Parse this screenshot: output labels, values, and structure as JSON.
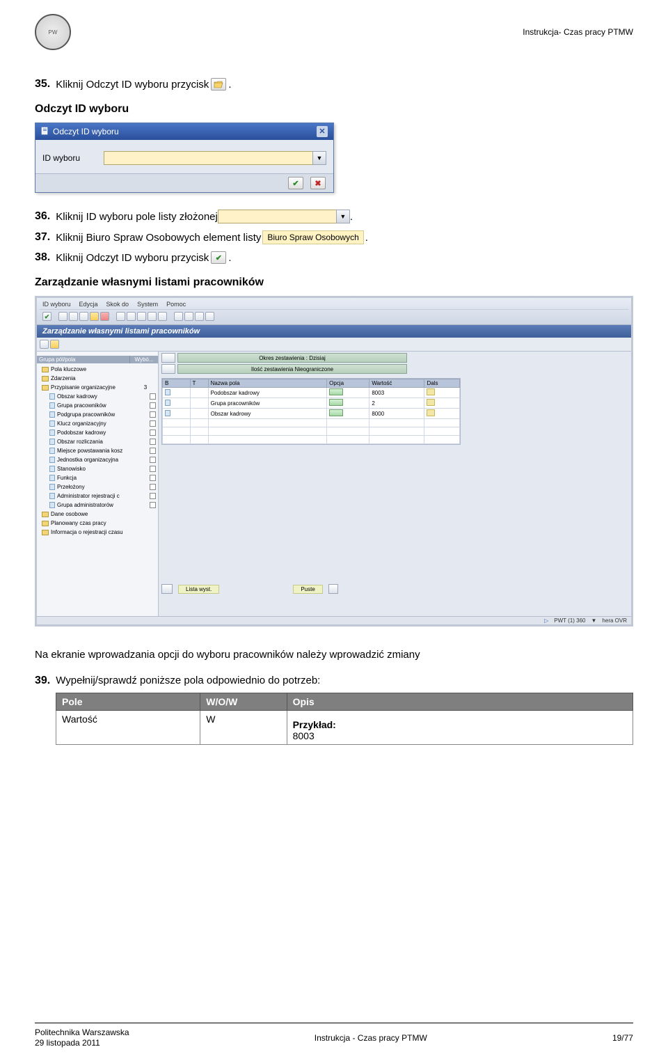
{
  "header": {
    "doc_title_short": "Instrukcja- Czas pracy PTMW"
  },
  "steps": {
    "s35": {
      "num": "35.",
      "text_before": "Kliknij Odczyt ID wyboru przycisk ",
      "text_after": "."
    },
    "heading1": "Odczyt ID wyboru",
    "s36": {
      "num": "36.",
      "text_before": "Kliknij ID wyboru pole listy złożonej ",
      "text_after": "."
    },
    "s37": {
      "num": "37.",
      "text_before": "Kliknij Biuro Spraw Osobowych element listy ",
      "badge": "Biuro Spraw Osobowych",
      "text_after": "."
    },
    "s38": {
      "num": "38.",
      "text_before": "Kliknij Odczyt ID wyboru przycisk ",
      "text_after": "."
    },
    "heading2": "Zarządzanie własnymi listami pracowników",
    "body": "Na ekranie wprowadzania opcji do wyboru pracowników należy wprowadzić zmiany",
    "s39": {
      "num": "39.",
      "text": "Wypełnij/sprawdź poniższe pola odpowiednio do potrzeb:"
    }
  },
  "dialog": {
    "title": "Odczyt ID wyboru",
    "field_label": "ID wyboru"
  },
  "sap_screen": {
    "menu": [
      "ID wyboru",
      "Edycja",
      "Skok do",
      "System",
      "Pomoc"
    ],
    "title": "Zarządzanie własnymi listami pracowników",
    "left_header": {
      "col1": "Grupa pól/pola",
      "col2": "Wybó..."
    },
    "tree": [
      {
        "lvl": 0,
        "type": "folder",
        "label": "Pola kluczowe",
        "check": false
      },
      {
        "lvl": 0,
        "type": "folder",
        "label": "Zdarzenia",
        "check": false
      },
      {
        "lvl": 0,
        "type": "folder",
        "label": "Przypisanie organizacyjne",
        "count": "3"
      },
      {
        "lvl": 1,
        "type": "doc",
        "label": "Obszar kadrowy",
        "check": true
      },
      {
        "lvl": 1,
        "type": "doc",
        "label": "Grupa pracowników",
        "check": true
      },
      {
        "lvl": 1,
        "type": "doc",
        "label": "Podgrupa pracowników",
        "check": true
      },
      {
        "lvl": 1,
        "type": "doc",
        "label": "Klucz organizacyjny",
        "check": true
      },
      {
        "lvl": 1,
        "type": "doc",
        "label": "Podobszar kadrowy",
        "check": true
      },
      {
        "lvl": 1,
        "type": "doc",
        "label": "Obszar rozliczania",
        "check": true
      },
      {
        "lvl": 1,
        "type": "doc",
        "label": "Miejsce powstawania kosz",
        "check": true
      },
      {
        "lvl": 1,
        "type": "doc",
        "label": "Jednostka organizacyjna",
        "check": true
      },
      {
        "lvl": 1,
        "type": "doc",
        "label": "Stanowisko",
        "check": true
      },
      {
        "lvl": 1,
        "type": "doc",
        "label": "Funkcja",
        "check": true
      },
      {
        "lvl": 1,
        "type": "doc",
        "label": "Przełożony",
        "check": true
      },
      {
        "lvl": 1,
        "type": "doc",
        "label": "Administrator rejestracji c",
        "check": true
      },
      {
        "lvl": 1,
        "type": "doc",
        "label": "Grupa administratorów",
        "check": true
      },
      {
        "lvl": 0,
        "type": "folder",
        "label": "Dane osobowe",
        "check": false
      },
      {
        "lvl": 0,
        "type": "folder",
        "label": "Planowany czas pracy",
        "check": false
      },
      {
        "lvl": 0,
        "type": "folder",
        "label": "Informacja o rejestracji czasu",
        "check": false
      }
    ],
    "right_bars": {
      "bar1": "Okres zestawienia : Dzisiaj",
      "bar2": "Ilość zestawienia Nieograniczone"
    },
    "grid_headers": [
      "B",
      "T",
      "Nazwa pola",
      "Opcja",
      "Wartość",
      "Dals"
    ],
    "grid_rows": [
      {
        "name": "Podobszar kadrowy",
        "value": "8003"
      },
      {
        "name": "Grupa pracowników",
        "value": "2"
      },
      {
        "name": "Obszar kadrowy",
        "value": "8000"
      }
    ],
    "bottom": {
      "lista": "Lista wyst.",
      "puste": "Puste"
    },
    "status": {
      "l": "PWT (1) 360",
      "r": "hera   OVR"
    }
  },
  "table": {
    "headers": {
      "c1": "Pole",
      "c2": "W/O/W",
      "c3": "Opis"
    },
    "row": {
      "c1": "Wartość",
      "c2": "W",
      "c3_label": "Przykład:",
      "c3_value": "8003"
    }
  },
  "footer": {
    "left1": "Politechnika Warszawska",
    "left2": "29 listopada 2011",
    "center": "Instrukcja - Czas pracy PTMW",
    "right": "19/77"
  }
}
